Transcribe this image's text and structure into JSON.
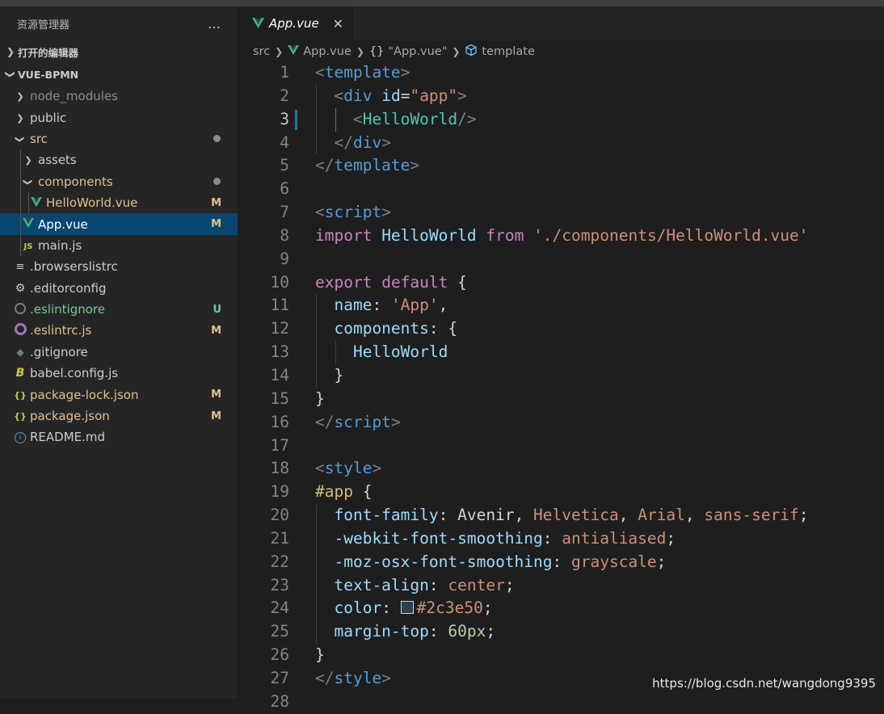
{
  "colors": {
    "sidebar_bg": "#252526",
    "editor_bg": "#1e1e1e",
    "selection_bg": "#094771",
    "modified": "#e2c08d",
    "untracked": "#73c991",
    "vue_green": "#41b883",
    "tag": "#569cd6",
    "attr": "#9cdcfe",
    "string": "#ce9178",
    "keyword": "#c586c0",
    "component": "#4ec9b0",
    "number": "#b5cea8"
  },
  "sidebar": {
    "title": "资源管理器",
    "more_icon": "…",
    "open_editors": "打开的编辑器",
    "project": "VUE-BPMN",
    "tree": [
      {
        "name": "node_modules",
        "type": "folder",
        "depth": 0,
        "color": "#8c8c8c",
        "icon": "chevron-right"
      },
      {
        "name": "public",
        "type": "folder",
        "depth": 0,
        "color": "#cccccc",
        "icon": "chevron-right"
      },
      {
        "name": "src",
        "type": "folder",
        "depth": 0,
        "color": "#e2c08d",
        "icon": "chevron-down",
        "dot": true
      },
      {
        "name": "assets",
        "type": "folder",
        "depth": 1,
        "color": "#cccccc",
        "icon": "chevron-right"
      },
      {
        "name": "components",
        "type": "folder",
        "depth": 1,
        "color": "#e2c08d",
        "icon": "chevron-down",
        "dot": true
      },
      {
        "name": "HelloWorld.vue",
        "type": "vue",
        "depth": 2,
        "color": "#e2c08d",
        "badge": "M"
      },
      {
        "name": "App.vue",
        "type": "vue",
        "depth": 1,
        "color": "#ffffff",
        "badge": "M",
        "selected": true
      },
      {
        "name": "main.js",
        "type": "js",
        "depth": 1,
        "color": "#cccccc"
      },
      {
        "name": ".browserslistrc",
        "type": "lines",
        "depth": 0,
        "color": "#cccccc"
      },
      {
        "name": ".editorconfig",
        "type": "gear",
        "depth": 0,
        "color": "#cccccc"
      },
      {
        "name": ".eslintignore",
        "type": "eslint",
        "depth": 0,
        "color": "#73c991",
        "badge": "U"
      },
      {
        "name": ".eslintrc.js",
        "type": "eslintrc",
        "depth": 0,
        "color": "#e2c08d",
        "badge": "M"
      },
      {
        "name": ".gitignore",
        "type": "git",
        "depth": 0,
        "color": "#cccccc"
      },
      {
        "name": "babel.config.js",
        "type": "babel",
        "depth": 0,
        "color": "#cccccc"
      },
      {
        "name": "package-lock.json",
        "type": "json",
        "depth": 0,
        "color": "#e2c08d",
        "badge": "M"
      },
      {
        "name": "package.json",
        "type": "json",
        "depth": 0,
        "color": "#e2c08d",
        "badge": "M"
      },
      {
        "name": "README.md",
        "type": "info",
        "depth": 0,
        "color": "#cccccc"
      }
    ]
  },
  "tab": {
    "label": "App.vue",
    "close_icon": "✕"
  },
  "breadcrumb": [
    "src",
    "App.vue",
    "\"App.vue\"",
    "template"
  ],
  "code_lines": [
    [
      [
        "<",
        "#808080"
      ],
      [
        "template",
        "#569cd6"
      ],
      [
        ">",
        "#808080"
      ]
    ],
    [
      [
        "  "
      ],
      [
        "<",
        "#808080"
      ],
      [
        "div",
        "#569cd6"
      ],
      [
        " "
      ],
      [
        "id",
        "#9cdcfe"
      ],
      [
        "=",
        "#d4d4d4"
      ],
      [
        "\"app\"",
        "#ce9178"
      ],
      [
        ">",
        "#808080"
      ]
    ],
    [
      [
        "    "
      ],
      [
        "<",
        "#808080"
      ],
      [
        "HelloWorld",
        "#4ec9b0"
      ],
      [
        "/>",
        "#808080"
      ]
    ],
    [
      [
        "  "
      ],
      [
        "</",
        "#808080"
      ],
      [
        "div",
        "#569cd6"
      ],
      [
        ">",
        "#808080"
      ]
    ],
    [
      [
        "</",
        "#808080"
      ],
      [
        "template",
        "#569cd6"
      ],
      [
        ">",
        "#808080"
      ]
    ],
    [],
    [
      [
        "<",
        "#808080"
      ],
      [
        "script",
        "#569cd6"
      ],
      [
        ">",
        "#808080"
      ]
    ],
    [
      [
        "import",
        "#c586c0"
      ],
      [
        " HelloWorld ",
        "#9cdcfe"
      ],
      [
        "from",
        "#c586c0"
      ],
      [
        " "
      ],
      [
        "'./components/HelloWorld.vue'",
        "#ce9178"
      ]
    ],
    [],
    [
      [
        "export",
        "#c586c0"
      ],
      [
        " "
      ],
      [
        "default",
        "#c586c0"
      ],
      [
        " {",
        "#d4d4d4"
      ]
    ],
    [
      [
        "  "
      ],
      [
        "name",
        "#9cdcfe"
      ],
      [
        ": ",
        "#d4d4d4"
      ],
      [
        "'App'",
        "#ce9178"
      ],
      [
        ",",
        "#d4d4d4"
      ]
    ],
    [
      [
        "  "
      ],
      [
        "components",
        "#9cdcfe"
      ],
      [
        ": {",
        "#d4d4d4"
      ]
    ],
    [
      [
        "    "
      ],
      [
        "HelloWorld",
        "#9cdcfe"
      ]
    ],
    [
      [
        "  }",
        "#d4d4d4"
      ]
    ],
    [
      [
        "}",
        "#d4d4d4"
      ]
    ],
    [
      [
        "</",
        "#808080"
      ],
      [
        "script",
        "#569cd6"
      ],
      [
        ">",
        "#808080"
      ]
    ],
    [],
    [
      [
        "<",
        "#808080"
      ],
      [
        "style",
        "#569cd6"
      ],
      [
        ">",
        "#808080"
      ]
    ],
    [
      [
        "#app",
        "#d7ba7d"
      ],
      [
        " {",
        "#d4d4d4"
      ]
    ],
    [
      [
        "  "
      ],
      [
        "font-family",
        "#9cdcfe"
      ],
      [
        ": ",
        "#d4d4d4"
      ],
      [
        "Avenir",
        "#d4d4d4"
      ],
      [
        ", ",
        "#d4d4d4"
      ],
      [
        "Helvetica",
        "#ce9178"
      ],
      [
        ", ",
        "#d4d4d4"
      ],
      [
        "Arial",
        "#ce9178"
      ],
      [
        ", ",
        "#d4d4d4"
      ],
      [
        "sans-serif",
        "#ce9178"
      ],
      [
        ";",
        "#d4d4d4"
      ]
    ],
    [
      [
        "  "
      ],
      [
        "-webkit-font-smoothing",
        "#9cdcfe"
      ],
      [
        ": ",
        "#d4d4d4"
      ],
      [
        "antialiased",
        "#ce9178"
      ],
      [
        ";",
        "#d4d4d4"
      ]
    ],
    [
      [
        "  "
      ],
      [
        "-moz-osx-font-smoothing",
        "#9cdcfe"
      ],
      [
        ": ",
        "#d4d4d4"
      ],
      [
        "grayscale",
        "#ce9178"
      ],
      [
        ";",
        "#d4d4d4"
      ]
    ],
    [
      [
        "  "
      ],
      [
        "text-align",
        "#9cdcfe"
      ],
      [
        ": ",
        "#d4d4d4"
      ],
      [
        "center",
        "#ce9178"
      ],
      [
        ";",
        "#d4d4d4"
      ]
    ],
    [
      [
        "  "
      ],
      [
        "color",
        "#9cdcfe"
      ],
      [
        ": ",
        "#d4d4d4"
      ],
      [
        "SWATCH"
      ],
      [
        "#2c3e50",
        "#ce9178"
      ],
      [
        ";",
        "#d4d4d4"
      ]
    ],
    [
      [
        "  "
      ],
      [
        "margin-top",
        "#9cdcfe"
      ],
      [
        ": ",
        "#d4d4d4"
      ],
      [
        "60px",
        "#b5cea8"
      ],
      [
        ";",
        "#d4d4d4"
      ]
    ],
    [
      [
        "}",
        "#d4d4d4"
      ]
    ],
    [
      [
        "</",
        "#808080"
      ],
      [
        "style",
        "#569cd6"
      ],
      [
        ">",
        "#808080"
      ]
    ],
    []
  ],
  "line_numbers": [
    "1",
    "2",
    "3",
    "4",
    "5",
    "6",
    "7",
    "8",
    "9",
    "10",
    "11",
    "12",
    "13",
    "14",
    "15",
    "16",
    "17",
    "18",
    "19",
    "20",
    "21",
    "22",
    "23",
    "24",
    "25",
    "26",
    "27",
    "28"
  ],
  "active_line": 3,
  "watermark": "https://blog.csdn.net/wangdong9395"
}
